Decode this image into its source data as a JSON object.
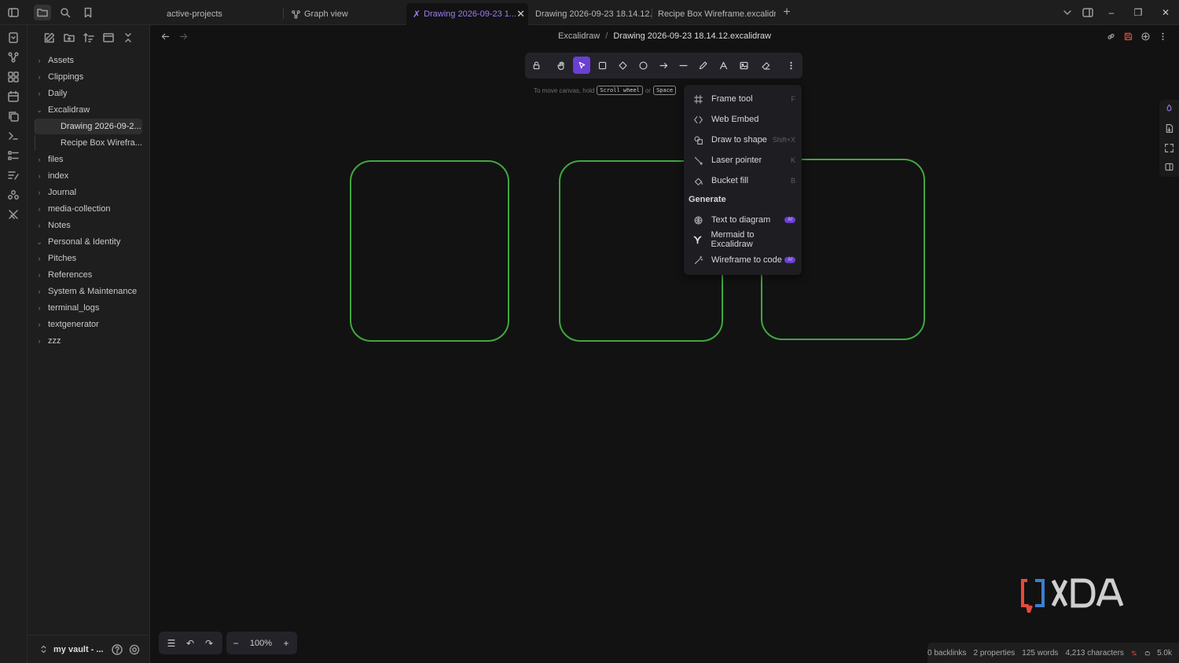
{
  "titlebar": {
    "tabs": [
      {
        "label": "active-projects",
        "active": false
      },
      {
        "label": "Graph view",
        "active": false
      },
      {
        "label": "Drawing 2026-09-23 1...",
        "active": true
      },
      {
        "label": "Drawing 2026-09-23 18.14.12....",
        "active": false
      },
      {
        "label": "Recipe Box Wireframe.excalidr...",
        "active": false
      }
    ],
    "new_tab": "+",
    "window_controls": {
      "minimize": "–",
      "restore": "❐",
      "close": "✕"
    }
  },
  "sidebar": {
    "tree": [
      {
        "label": "Assets",
        "expanded": false
      },
      {
        "label": "Clippings",
        "expanded": false
      },
      {
        "label": "Daily",
        "expanded": false
      },
      {
        "label": "Excalidraw",
        "expanded": true
      },
      {
        "label": "files",
        "expanded": false
      },
      {
        "label": "index",
        "expanded": false
      },
      {
        "label": "Journal",
        "expanded": false
      },
      {
        "label": "media-collection",
        "expanded": false
      },
      {
        "label": "Notes",
        "expanded": false
      },
      {
        "label": "Personal & Identity",
        "expanded": true
      },
      {
        "label": "Pitches",
        "expanded": false
      },
      {
        "label": "References",
        "expanded": false
      },
      {
        "label": "System & Maintenance",
        "expanded": false
      },
      {
        "label": "terminal_logs",
        "expanded": false
      },
      {
        "label": "textgenerator",
        "expanded": false
      },
      {
        "label": "zzz",
        "expanded": false
      }
    ],
    "excalidraw_children": [
      "Drawing 2026-09-2...",
      "Recipe Box Wirefra..."
    ],
    "vault_name": "my vault - ..."
  },
  "header": {
    "breadcrumb_parent": "Excalidraw",
    "breadcrumb_sep": "/",
    "breadcrumb_current": "Drawing 2026-09-23 18.14.12.excalidraw"
  },
  "canvas": {
    "hint_prefix": "To move canvas, hold",
    "hint_key1": "Scroll wheel",
    "hint_or": "or",
    "hint_key2": "Space",
    "shape_color": "#3fa83f"
  },
  "menu": {
    "items": [
      {
        "label": "Frame tool",
        "shortcut": "F"
      },
      {
        "label": "Web Embed",
        "shortcut": ""
      },
      {
        "label": "Draw to shape",
        "shortcut": "Shift+X"
      },
      {
        "label": "Laser pointer",
        "shortcut": "K"
      },
      {
        "label": "Bucket fill",
        "shortcut": "B"
      }
    ],
    "generate_heading": "Generate",
    "generate_items": [
      {
        "label": "Text to diagram",
        "badge": "AI"
      },
      {
        "label": "Mermaid to Excalidraw",
        "badge": ""
      },
      {
        "label": "Wireframe to code",
        "badge": "AI"
      }
    ]
  },
  "bottom": {
    "zoom": "100%",
    "zoom_out": "−",
    "zoom_in": "+"
  },
  "statusbar": {
    "backlinks": "0 backlinks",
    "properties": "2 properties",
    "words": "125 words",
    "characters": "4,213 characters",
    "size": "5.0k"
  },
  "colors": {
    "accent": "#6a3fd3",
    "active_tab": "#9b7cf0",
    "xda_red": "#e84a3c",
    "xda_blue": "#3a7fd1"
  }
}
